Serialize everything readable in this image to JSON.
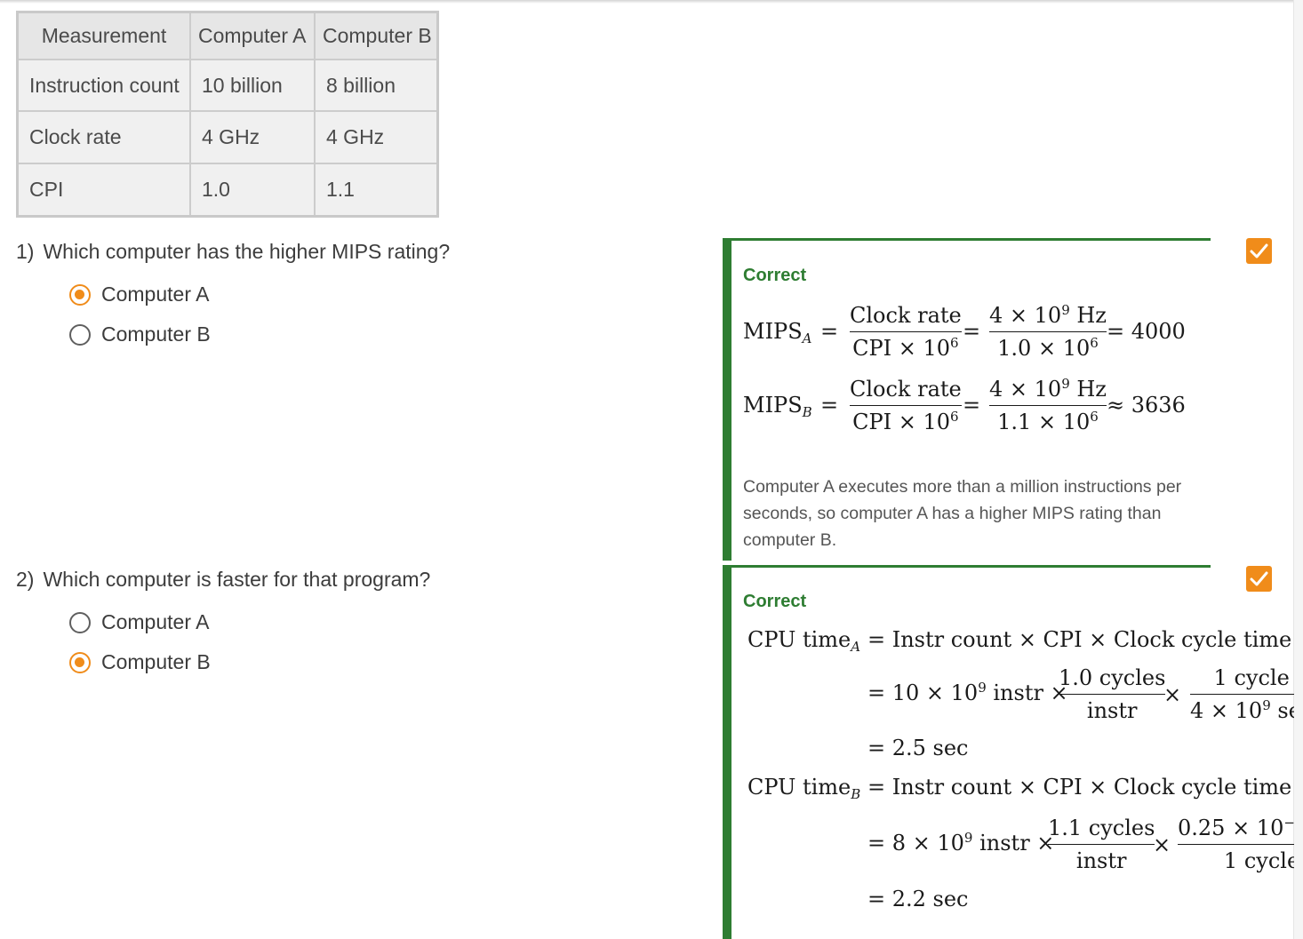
{
  "table": {
    "headers": [
      "Measurement",
      "Computer A",
      "Computer B"
    ],
    "rows": [
      [
        "Instruction count",
        "10 billion",
        "8 billion"
      ],
      [
        "Clock rate",
        "4 GHz",
        "4 GHz"
      ],
      [
        "CPI",
        "1.0",
        "1.1"
      ]
    ]
  },
  "questions": [
    {
      "number": "1)",
      "prompt": "Which computer has the higher MIPS rating?",
      "options": [
        {
          "label": "Computer A",
          "selected": true
        },
        {
          "label": "Computer B",
          "selected": false
        }
      ],
      "feedback": {
        "status": "Correct",
        "explanation": "Computer A executes more than a million instructions per seconds, so computer A has a higher MIPS rating than computer B."
      }
    },
    {
      "number": "2)",
      "prompt": "Which computer is faster for that program?",
      "options": [
        {
          "label": "Computer A",
          "selected": false
        },
        {
          "label": "Computer B",
          "selected": true
        }
      ],
      "feedback": {
        "status": "Correct"
      }
    }
  ],
  "colors": {
    "accent": "#f08c1a",
    "correct": "#2e7d32",
    "table_header_bg": "#e6e6e6",
    "table_cell_bg": "#f0f0f0"
  },
  "icons": {
    "selected_radio": "radio-selected-icon",
    "unselected_radio": "radio-unselected-icon",
    "completion": "checkmark-icon"
  }
}
